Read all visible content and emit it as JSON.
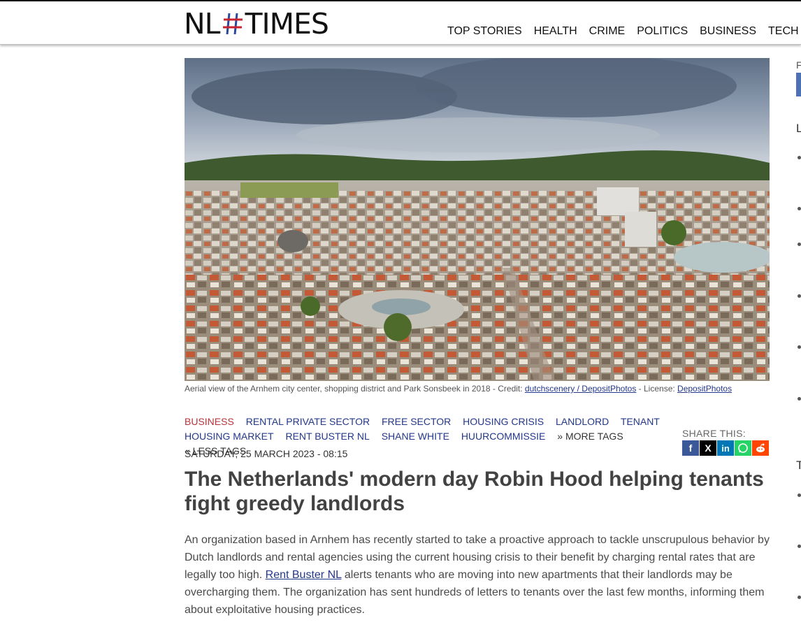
{
  "header": {
    "logo": {
      "left": "NL",
      "mark": "#",
      "right": "TIMES"
    },
    "nav": [
      "TOP STORIES",
      "HEALTH",
      "CRIME",
      "POLITICS",
      "BUSINESS",
      "TECH"
    ]
  },
  "image": {
    "alt": "Aerial view of the Arnhem city center",
    "caption_prefix": "Aerial view of the Arnhem city center, shopping district and Park Sonsbeek in 2018 - Credit: ",
    "credit_link": "dutchscenery / DepositPhotos",
    "license_prefix": " - License: ",
    "license_link": "DepositPhotos"
  },
  "tags": {
    "category": "BUSINESS",
    "items": [
      "RENTAL PRIVATE SECTOR",
      "FREE SECTOR",
      "HOUSING CRISIS",
      "LANDLORD",
      "TENANT",
      "HOUSING MARKET",
      "RENT BUSTER NL",
      "SHANE WHITE",
      "HUURCOMMISSIE"
    ],
    "more": "» MORE TAGS",
    "less": "« LESS TAGS"
  },
  "share": {
    "label": "SHARE THIS:",
    "icons": [
      {
        "name": "facebook-icon",
        "glyph": "f",
        "color": "#3b5998"
      },
      {
        "name": "x-icon",
        "glyph": "X",
        "color": "#000000"
      },
      {
        "name": "linkedin-icon",
        "glyph": "in",
        "color": "#0077b5"
      },
      {
        "name": "whatsapp-icon",
        "glyph": "",
        "color": "#25d366"
      },
      {
        "name": "reddit-icon",
        "glyph": "",
        "color": "#ff4500"
      }
    ]
  },
  "article": {
    "date": "SATURDAY, 25 MARCH 2023 - 08:15",
    "title": "The Netherlands' modern day Robin Hood helping tenants fight greedy landlords",
    "body_before_link": "An organization based in Arnhem has recently started to take a proactive approach to tackle unscrupulous behavior by Dutch landlords and rental agencies using the current housing crisis to their benefit by charging rental rates that are legally too high. ",
    "body_link": "Rent Buster NL",
    "body_after_link": " alerts tenants who are moving into new apartments that their landlords may be overcharging them. The organization has sent hundreds of letters to tenants over the last few months, informing them about exploitative housing practices."
  },
  "sidebar": {
    "fragment_f": "F",
    "fragment_l": "L",
    "fragment_t": "T"
  },
  "colors": {
    "tag": "#23378b",
    "category": "#b8343b",
    "title": "#424242"
  }
}
